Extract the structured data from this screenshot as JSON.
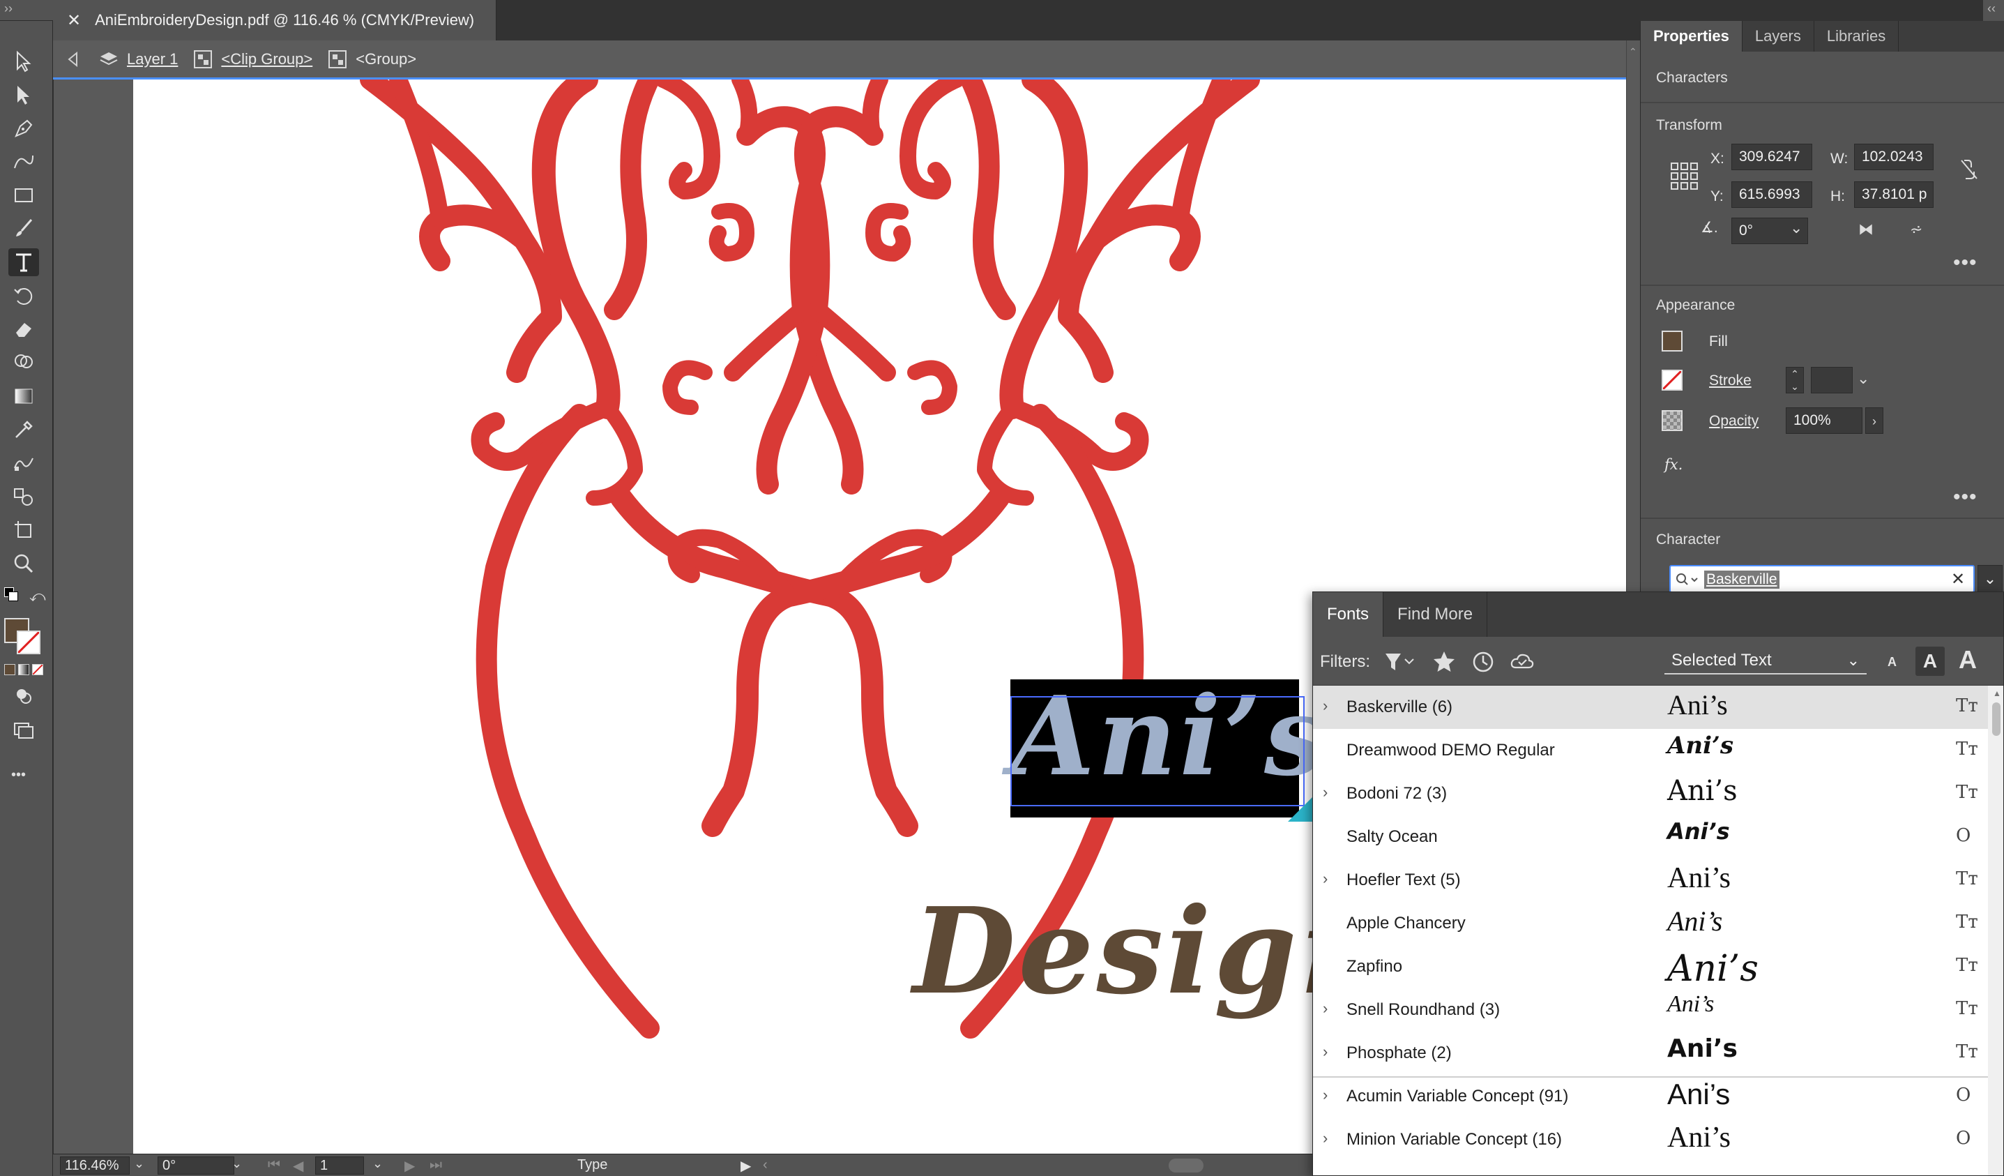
{
  "document": {
    "tab_title": "AniEmbroideryDesign.pdf @ 116.46 % (CMYK/Preview)",
    "close_glyph": "✕"
  },
  "breadcrumb": {
    "layer": "Layer 1",
    "clip_group": "<Clip Group>",
    "group": "<Group>"
  },
  "toolbar": {
    "tools": [
      "selection-tool",
      "direct-selection-tool",
      "pen-tool",
      "curvature-tool",
      "rectangle-tool",
      "paintbrush-tool",
      "type-tool",
      "rotate-tool",
      "eraser-tool",
      "shape-builder-tool",
      "gradient-tool",
      "eyedropper-tool",
      "blend-tool",
      "live-paint-tool",
      "artboard-tool",
      "zoom-tool"
    ],
    "active_tool": "type-tool",
    "fill_color": "#5e4a36",
    "more_glyph": "•••"
  },
  "canvas": {
    "text_top": "Ani’s",
    "text_bottom": "Design’s",
    "art_color": "#d93a36",
    "text_top_color": "#9fb0ca",
    "text_bottom_color": "#5e4a36"
  },
  "statusbar": {
    "zoom": "116.46%",
    "rotation": "0°",
    "artboard": "1",
    "tool_label": "Type"
  },
  "panel": {
    "tabs": [
      "Properties",
      "Layers",
      "Libraries"
    ],
    "active_tab": "Properties",
    "characters_title": "Characters",
    "transform_title": "Transform",
    "x_label": "X:",
    "x_value": "309.6247",
    "y_label": "Y:",
    "y_value": "615.6993",
    "w_label": "W:",
    "w_value": "102.0243",
    "h_label": "H:",
    "h_value": "37.8101 p",
    "angle_value": "0°",
    "appearance_title": "Appearance",
    "fill_label": "Fill",
    "stroke_label": "Stroke",
    "opacity_label": "Opacity",
    "opacity_value": "100%",
    "fx_label": "fx.",
    "character_title": "Character",
    "font_search": "Baskerville",
    "more_glyph": "•••"
  },
  "font_menu": {
    "tabs": [
      "Fonts",
      "Find More"
    ],
    "active_tab": "Fonts",
    "filters_label": "Filters:",
    "show_option": "Selected Text",
    "sample_text": "Ani’s",
    "fonts": [
      {
        "name": "Baskerville (6)",
        "expandable": true,
        "selected": true,
        "type": "Tт"
      },
      {
        "name": "Dreamwood DEMO Regular",
        "expandable": false,
        "selected": false,
        "type": "Tт"
      },
      {
        "name": "Bodoni 72 (3)",
        "expandable": true,
        "selected": false,
        "type": "Tт"
      },
      {
        "name": "Salty Ocean",
        "expandable": false,
        "selected": false,
        "type": "O"
      },
      {
        "name": "Hoefler Text (5)",
        "expandable": true,
        "selected": false,
        "type": "Tт"
      },
      {
        "name": "Apple Chancery",
        "expandable": false,
        "selected": false,
        "type": "Tт"
      },
      {
        "name": "Zapfino",
        "expandable": false,
        "selected": false,
        "type": "Tт"
      },
      {
        "name": "Snell Roundhand (3)",
        "expandable": true,
        "selected": false,
        "type": "Tт"
      },
      {
        "name": "Phosphate (2)",
        "expandable": true,
        "selected": false,
        "type": "Tт"
      },
      {
        "name": "Acumin Variable Concept (91)",
        "expandable": true,
        "selected": false,
        "type": "O"
      },
      {
        "name": "Minion Variable Concept (16)",
        "expandable": true,
        "selected": false,
        "type": "O"
      }
    ]
  }
}
